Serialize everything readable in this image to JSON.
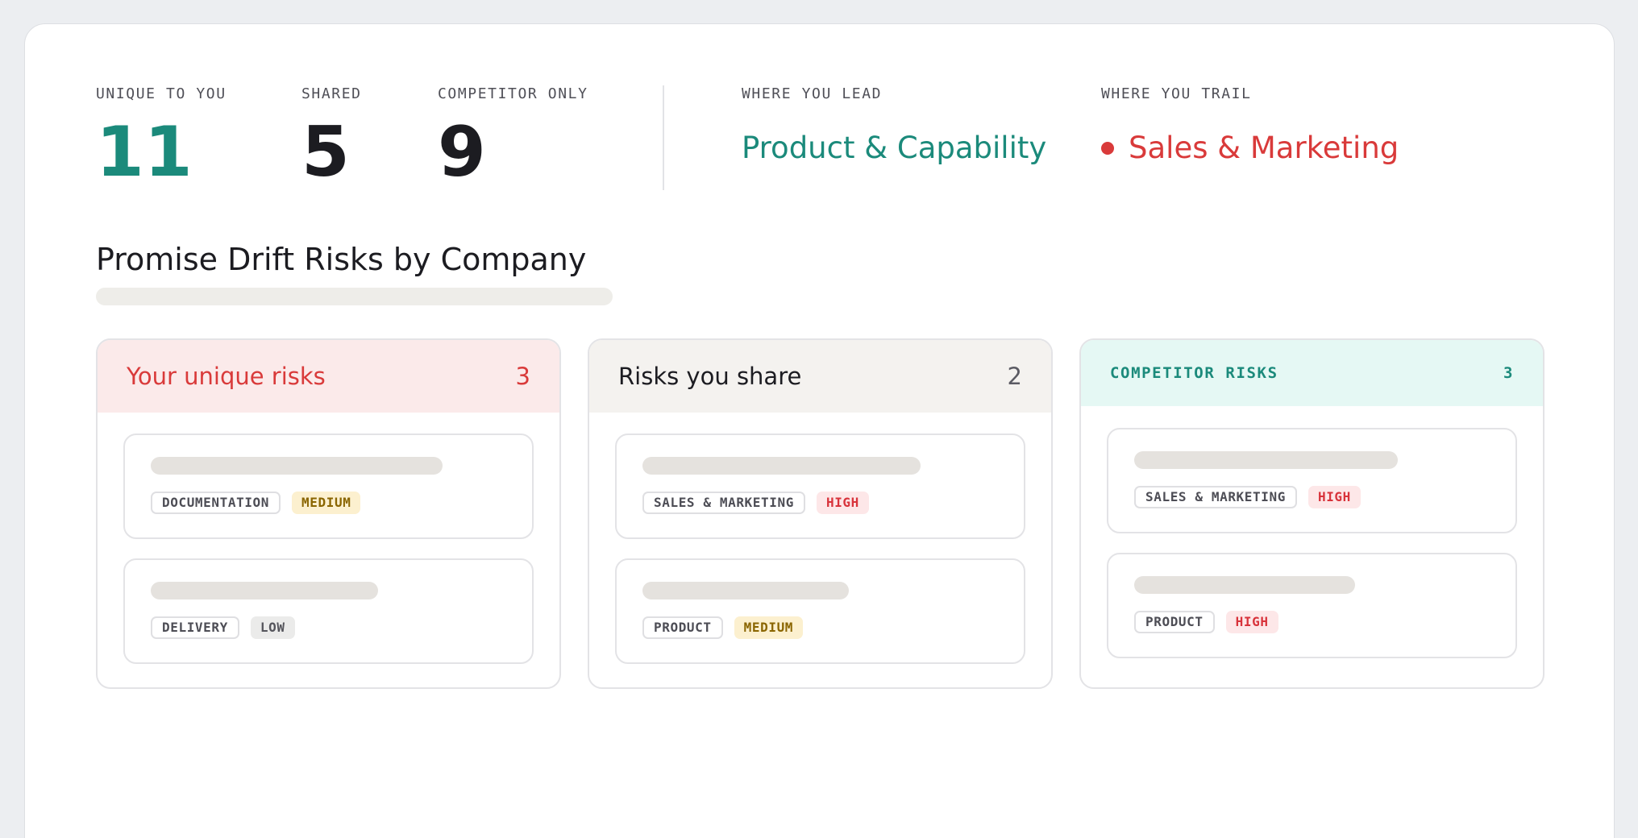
{
  "stats": {
    "unique": {
      "label": "UNIQUE TO YOU",
      "value": "11"
    },
    "shared": {
      "label": "SHARED",
      "value": "5"
    },
    "competitor": {
      "label": "COMPETITOR ONLY",
      "value": "9"
    }
  },
  "lead": {
    "label": "WHERE YOU LEAD",
    "value": "Product & Capability"
  },
  "trail": {
    "label": "WHERE YOU TRAIL",
    "value": "Sales & Marketing"
  },
  "section": {
    "title": "Promise Drift Risks by Company"
  },
  "columns": {
    "unique": {
      "title": "Your unique risks",
      "count": "3",
      "items": [
        {
          "category": "DOCUMENTATION",
          "severity": "MEDIUM"
        },
        {
          "category": "DELIVERY",
          "severity": "LOW"
        }
      ]
    },
    "shared": {
      "title": "Risks you share",
      "count": "2",
      "items": [
        {
          "category": "SALES & MARKETING",
          "severity": "HIGH"
        },
        {
          "category": "PRODUCT",
          "severity": "MEDIUM"
        }
      ]
    },
    "competitor": {
      "title": "COMPETITOR RISKS",
      "count": "3",
      "items": [
        {
          "category": "SALES & MARKETING",
          "severity": "HIGH"
        },
        {
          "category": "PRODUCT",
          "severity": "HIGH"
        }
      ]
    }
  },
  "colors": {
    "accent_teal": "#1b8a7b",
    "accent_red": "#d93a3a",
    "severity_high": "#d8333b",
    "severity_medium": "#8a6500",
    "severity_low": "#55555c"
  }
}
